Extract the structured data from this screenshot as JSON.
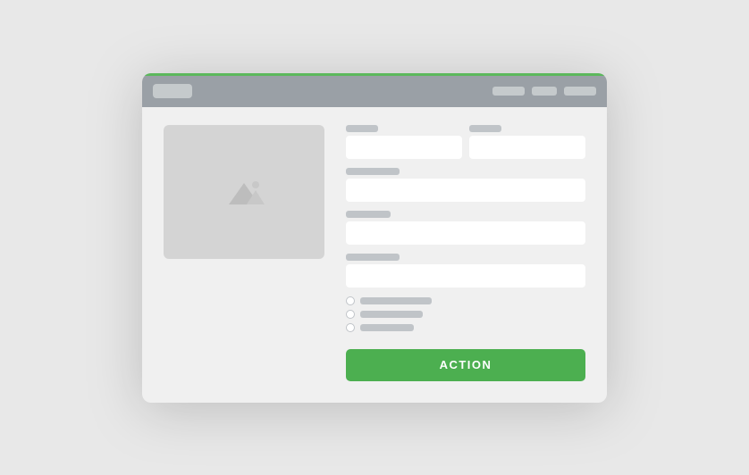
{
  "window": {
    "titlebar": {
      "tab_label": "",
      "stub1_width": 36,
      "stub2_width": 28,
      "stub3_width": 36
    },
    "form": {
      "row1": {
        "field1_label": "",
        "field2_label": ""
      },
      "row2_label": "",
      "row3_label": "",
      "row4_label": "",
      "checkboxes": [
        {
          "label_width": 80
        },
        {
          "label_width": 70
        },
        {
          "label_width": 60
        }
      ],
      "action_button": "ACTION"
    }
  }
}
